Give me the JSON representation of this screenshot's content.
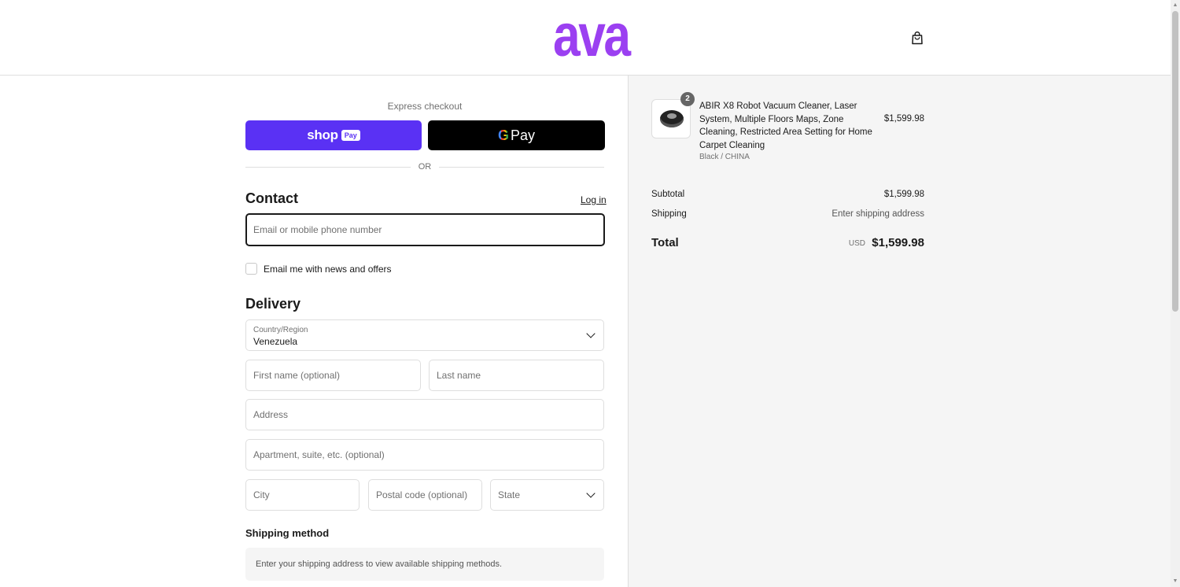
{
  "header": {
    "logo": "ava",
    "logo_color": "#9b40f1",
    "cart_icon": "shopping-bag-icon"
  },
  "express": {
    "label": "Express checkout",
    "shop_pay_text": "shop",
    "shop_pay_badge": "Pay",
    "shop_pay_color": "#5a31f4",
    "gpay_g": "G",
    "gpay_text": "Pay",
    "or_text": "OR"
  },
  "contact": {
    "title": "Contact",
    "login_link": "Log in",
    "email_placeholder": "Email or mobile phone number",
    "newsletter_label": "Email me with news and offers"
  },
  "delivery": {
    "title": "Delivery",
    "country_label": "Country/Region",
    "country_value": "Venezuela",
    "first_name_placeholder": "First name (optional)",
    "last_name_placeholder": "Last name",
    "address_placeholder": "Address",
    "apartment_placeholder": "Apartment, suite, etc. (optional)",
    "city_placeholder": "City",
    "postal_placeholder": "Postal code (optional)",
    "state_placeholder": "State"
  },
  "shipping_method": {
    "title": "Shipping method",
    "message": "Enter your shipping address to view available shipping methods."
  },
  "summary": {
    "product": {
      "quantity": "2",
      "name": "ABIR X8 Robot Vacuum Cleaner, Laser System, Multiple Floors Maps, Zone Cleaning, Restricted Area Setting for Home Carpet Cleaning",
      "variant": "Black / CHINA",
      "price": "$1,599.98"
    },
    "subtotal_label": "Subtotal",
    "subtotal_value": "$1,599.98",
    "shipping_label": "Shipping",
    "shipping_value": "Enter shipping address",
    "total_label": "Total",
    "total_currency": "USD",
    "total_value": "$1,599.98"
  }
}
